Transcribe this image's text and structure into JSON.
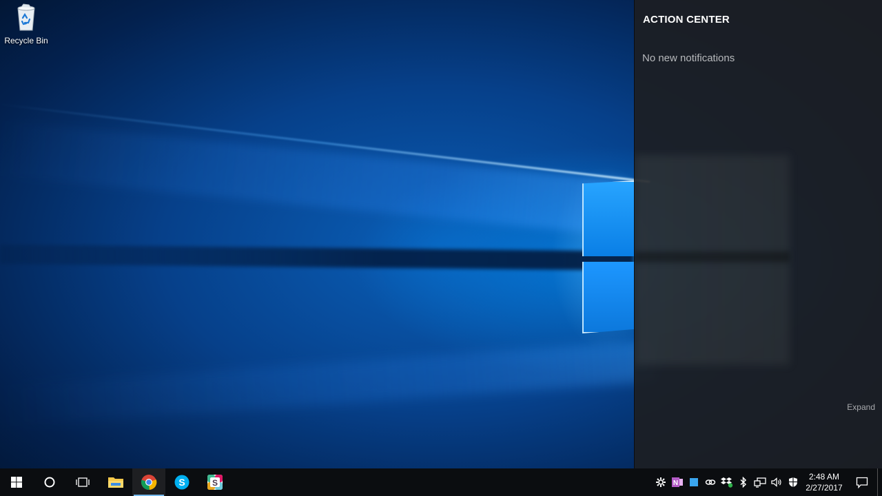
{
  "desktop": {
    "icons": [
      {
        "label": "Recycle Bin",
        "icon": "recycle-bin-icon"
      }
    ]
  },
  "action_center": {
    "title": "ACTION CENTER",
    "empty_message": "No new notifications",
    "expand_label": "Expand"
  },
  "taskbar": {
    "start": {
      "icon": "windows-logo-icon"
    },
    "search": {
      "icon": "cortana-circle-icon"
    },
    "task_view": {
      "icon": "task-view-icon"
    },
    "pinned": [
      {
        "name": "File Explorer",
        "icon": "folder-icon"
      },
      {
        "name": "Google Chrome",
        "icon": "chrome-icon",
        "active": true
      },
      {
        "name": "Skype",
        "icon": "skype-icon"
      },
      {
        "name": "Slack",
        "icon": "slack-icon"
      }
    ],
    "tray": [
      {
        "icon": "settings-gear-icon"
      },
      {
        "icon": "onenote-icon"
      },
      {
        "icon": "blue-square-icon"
      },
      {
        "icon": "link-icon"
      },
      {
        "icon": "dropbox-icon"
      },
      {
        "icon": "bluetooth-icon"
      },
      {
        "icon": "network-icon"
      },
      {
        "icon": "volume-icon"
      },
      {
        "icon": "defender-shield-icon"
      }
    ],
    "clock": {
      "time": "2:48 AM",
      "date": "2/27/2017"
    },
    "notification_icon": "action-center-icon"
  },
  "colors": {
    "accent": "#76b9ed",
    "taskbar": "#0b0d10",
    "action_center_bg": "#1c1e22"
  }
}
